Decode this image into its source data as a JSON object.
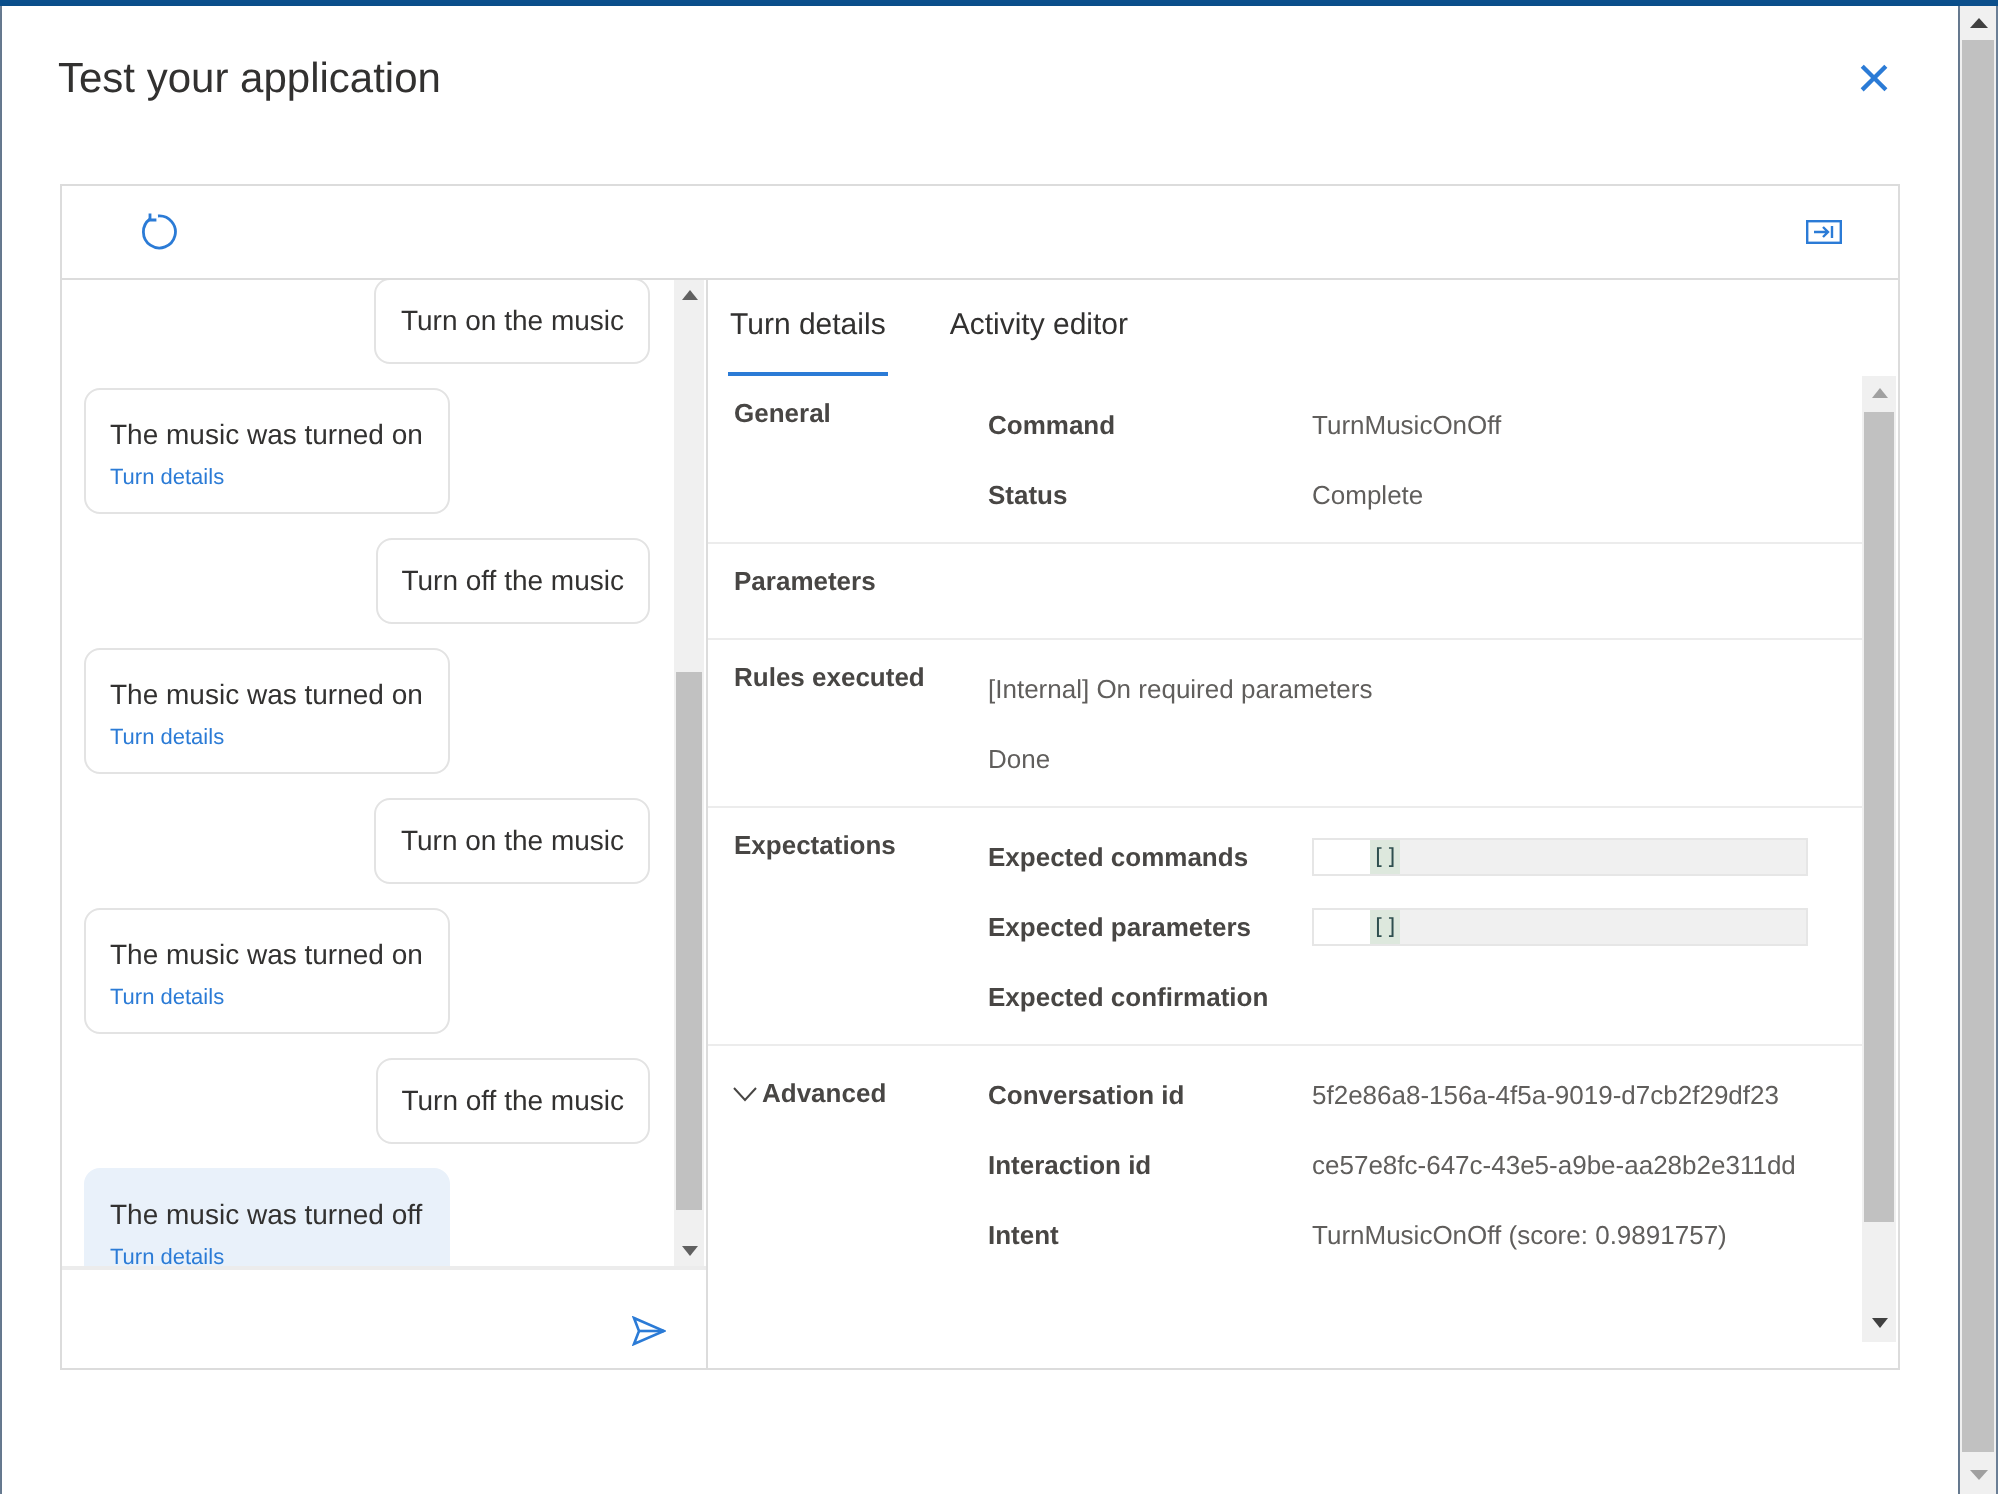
{
  "dialog": {
    "title": "Test your application",
    "close_glyph": "×"
  },
  "chat": {
    "messages": [
      {
        "kind": "user",
        "text": "Turn on the music"
      },
      {
        "kind": "bot",
        "text": "The music was turned on",
        "link": "Turn details",
        "selected": false
      },
      {
        "kind": "user",
        "text": "Turn off the music"
      },
      {
        "kind": "bot",
        "text": "The music was turned on",
        "link": "Turn details",
        "selected": false
      },
      {
        "kind": "user",
        "text": "Turn on the music"
      },
      {
        "kind": "bot",
        "text": "The music was turned on",
        "link": "Turn details",
        "selected": false
      },
      {
        "kind": "user",
        "text": "Turn off the music"
      },
      {
        "kind": "bot",
        "text": "The music was turned off",
        "link": "Turn details",
        "selected": true
      }
    ]
  },
  "tabs": [
    {
      "label": "Turn details",
      "selected": true
    },
    {
      "label": "Activity editor",
      "selected": false
    }
  ],
  "sections": [
    {
      "title": "General",
      "rows": [
        {
          "kind": "pair",
          "label": "Command",
          "value": "TurnMusicOnOff"
        },
        {
          "kind": "pair",
          "label": "Status",
          "value": "Complete"
        }
      ]
    },
    {
      "title": "Parameters"
    },
    {
      "title": "Rules executed",
      "rows": [
        {
          "kind": "plain",
          "value": "[Internal] On required parameters"
        },
        {
          "kind": "plain",
          "value": "Done"
        }
      ]
    },
    {
      "title": "Expectations",
      "rows": [
        {
          "kind": "editor",
          "label": "Expected commands",
          "value": "[]"
        },
        {
          "kind": "editor",
          "label": "Expected parameters",
          "value": "[]"
        },
        {
          "kind": "pair",
          "label": "Expected confirmation"
        }
      ]
    },
    {
      "title": "Advanced",
      "expanded": true,
      "rows": [
        {
          "kind": "pair",
          "label": "Conversation id",
          "value": "5f2e86a8-156a-4f5a-9019-d7cb2f29df23"
        },
        {
          "kind": "pair",
          "label": "Interaction id",
          "value": "ce57e8fc-647c-43e5-a9be-aa28b2e311dd"
        },
        {
          "kind": "pair",
          "label": "Intent",
          "value": "TurnMusicOnOff (score: 0.9891757)"
        }
      ]
    }
  ]
}
